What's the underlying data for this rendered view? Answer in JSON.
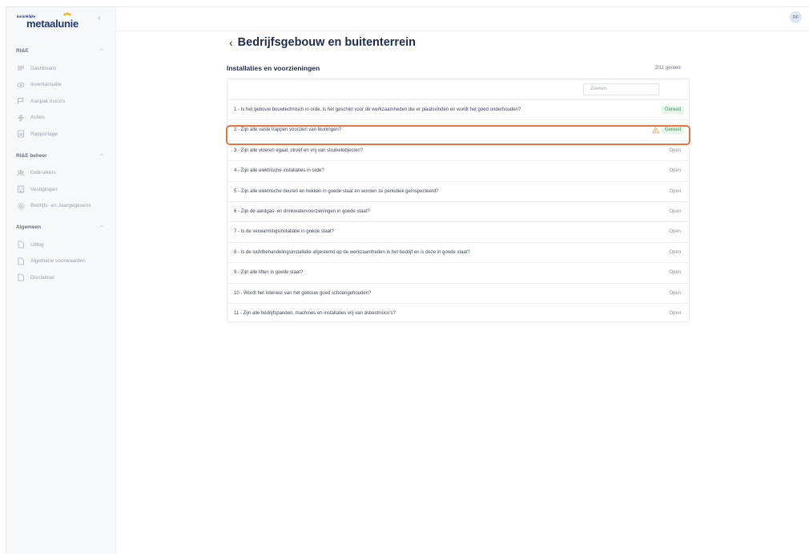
{
  "brand": {
    "small": "koninklijke",
    "name": "metaalunie"
  },
  "sidebar": {
    "sections": [
      {
        "title": "RI&E",
        "items": [
          {
            "label": "Dashboard",
            "icon": "list-icon"
          },
          {
            "label": "Inventarisatie",
            "icon": "eye-icon"
          },
          {
            "label": "Aanpak risico's",
            "icon": "flag-icon"
          },
          {
            "label": "Acties",
            "icon": "bolt-icon"
          },
          {
            "label": "Rapportage",
            "icon": "report-icon"
          }
        ]
      },
      {
        "title": "RI&E beheer",
        "items": [
          {
            "label": "Gebruikers",
            "icon": "users-icon"
          },
          {
            "label": "Vestigingen",
            "icon": "building-icon"
          },
          {
            "label": "Bedrijfs- en Jaargegevens",
            "icon": "gear-icon"
          }
        ]
      },
      {
        "title": "Algemeen",
        "items": [
          {
            "label": "Uitleg",
            "icon": "document-icon"
          },
          {
            "label": "Algemene voorwaarden",
            "icon": "document-icon"
          },
          {
            "label": "Disclaimer",
            "icon": "document-icon"
          }
        ]
      }
    ]
  },
  "user": {
    "initials": "RF"
  },
  "page": {
    "title": "Bedrijfsgebouw en buitenterrein",
    "section_title": "Installaties en voorzieningen",
    "progress": "2/11 gereed",
    "search_placeholder": "Zoeken"
  },
  "questions": [
    {
      "text": "1 - Is het gebouw bouwtechnisch in orde, is het geschikt voor de werkzaamheden die er plaatsvinden en wordt het goed onderhouden?",
      "status": "Gereed",
      "done": true,
      "warning": false
    },
    {
      "text": "2 - Zijn alle vaste trappen voorzien van leuningen?",
      "status": "Gereed",
      "done": true,
      "warning": true
    },
    {
      "text": "3 - Zijn alle vloeren egaal, stroef en vrij van struikelobjecten?",
      "status": "Open",
      "done": false,
      "warning": false
    },
    {
      "text": "4 - Zijn alle elektrische installaties in orde?",
      "status": "Open",
      "done": false,
      "warning": false
    },
    {
      "text": "5 - Zijn alle elektrische deuren en hekken in goede staat en worden ze periodiek geïnspecteerd?",
      "status": "Open",
      "done": false,
      "warning": false
    },
    {
      "text": "6 - Zijn de aardgas- en drinkwatervoorzieningen in goede staat?",
      "status": "Open",
      "done": false,
      "warning": false
    },
    {
      "text": "7 - Is de verwarmingsinstallatie in goede staat?",
      "status": "Open",
      "done": false,
      "warning": false
    },
    {
      "text": "8 - Is de luchtbehandelingsinstallatie afgestemd op de werkzaamheden in het bedrijf en is deze in goede staat?",
      "status": "Open",
      "done": false,
      "warning": false
    },
    {
      "text": "9 - Zijn alle liften in goede staat?",
      "status": "Open",
      "done": false,
      "warning": false
    },
    {
      "text": "10 - Wordt het interieur van het gebouw goed schoongehouden?",
      "status": "Open",
      "done": false,
      "warning": false
    },
    {
      "text": "11 - Zijn alle bedrijfspanden, machines en installaties vrij van asbestrisico's?",
      "status": "Open",
      "done": false,
      "warning": false
    }
  ],
  "colors": {
    "accent": "#1e3a6e",
    "done": "#3f9a57",
    "warning": "#e8a93f",
    "highlight": "#e8743f"
  }
}
